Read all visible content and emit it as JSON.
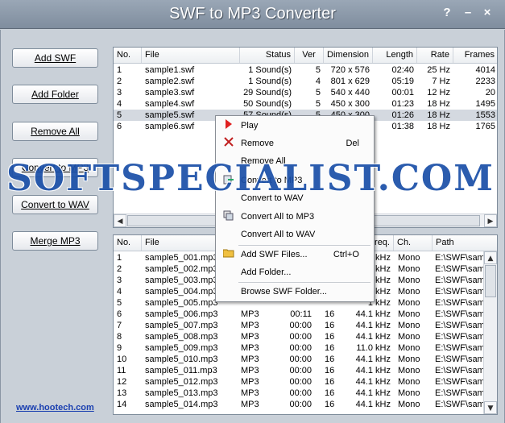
{
  "window": {
    "title": "SWF to MP3 Converter",
    "help_glyph": "?",
    "minimize_glyph": "–",
    "close_glyph": "×"
  },
  "sidebar": {
    "buttons": [
      {
        "label": "Add SWF"
      },
      {
        "label": "Add Folder"
      },
      {
        "label": "Remove All"
      },
      {
        "label": "Convert to MP3"
      },
      {
        "label": "Convert to WAV"
      },
      {
        "label": "Merge MP3"
      }
    ],
    "link": "www.hootech.com"
  },
  "swf_list": {
    "headers": [
      "No.",
      "File",
      "Status",
      "Ver",
      "Dimension",
      "Length",
      "Rate",
      "Frames"
    ],
    "rows": [
      {
        "no": "1",
        "file": "sample1.swf",
        "status": "1 Sound(s)",
        "ver": "5",
        "dim": "720 x 576",
        "length": "02:40",
        "rate": "25 Hz",
        "frames": "4014"
      },
      {
        "no": "2",
        "file": "sample2.swf",
        "status": "1 Sound(s)",
        "ver": "4",
        "dim": "801 x 629",
        "length": "05:19",
        "rate": "7 Hz",
        "frames": "2233"
      },
      {
        "no": "3",
        "file": "sample3.swf",
        "status": "29 Sound(s)",
        "ver": "5",
        "dim": "540 x 440",
        "length": "00:01",
        "rate": "12 Hz",
        "frames": "20"
      },
      {
        "no": "4",
        "file": "sample4.swf",
        "status": "50 Sound(s)",
        "ver": "5",
        "dim": "450 x 300",
        "length": "01:23",
        "rate": "18 Hz",
        "frames": "1495"
      },
      {
        "no": "5",
        "file": "sample5.swf",
        "status": "57 Sound(s)",
        "ver": "5",
        "dim": "450 x 300",
        "length": "01:26",
        "rate": "18 Hz",
        "frames": "1553"
      },
      {
        "no": "6",
        "file": "sample6.swf",
        "status": "",
        "ver": "",
        "dim": "",
        "length": "01:38",
        "rate": "18 Hz",
        "frames": "1765"
      }
    ],
    "selected_index": 4
  },
  "mp3_list": {
    "headers": [
      "No.",
      "File",
      "",
      "",
      "",
      "req.",
      "Ch.",
      "Path"
    ],
    "rows": [
      {
        "no": "1",
        "file": "sample5_001.mp3",
        "fmt": "",
        "len": "",
        "bits": "",
        "freq": "1 kHz",
        "ch": "Mono",
        "path": "E:\\SWF\\sam"
      },
      {
        "no": "2",
        "file": "sample5_002.mp3",
        "fmt": "",
        "len": "",
        "bits": "",
        "freq": "1 kHz",
        "ch": "Mono",
        "path": "E:\\SWF\\sam"
      },
      {
        "no": "3",
        "file": "sample5_003.mp3",
        "fmt": "",
        "len": "",
        "bits": "",
        "freq": "1 kHz",
        "ch": "Mono",
        "path": "E:\\SWF\\sam"
      },
      {
        "no": "4",
        "file": "sample5_004.mp3",
        "fmt": "",
        "len": "",
        "bits": "",
        "freq": "1 kHz",
        "ch": "Mono",
        "path": "E:\\SWF\\sam"
      },
      {
        "no": "5",
        "file": "sample5_005.mp3",
        "fmt": "",
        "len": "",
        "bits": "",
        "freq": "1 kHz",
        "ch": "Mono",
        "path": "E:\\SWF\\sam"
      },
      {
        "no": "6",
        "file": "sample5_006.mp3",
        "fmt": "MP3",
        "len": "00:11",
        "bits": "16",
        "freq": "44.1 kHz",
        "ch": "Mono",
        "path": "E:\\SWF\\sam"
      },
      {
        "no": "7",
        "file": "sample5_007.mp3",
        "fmt": "MP3",
        "len": "00:00",
        "bits": "16",
        "freq": "44.1 kHz",
        "ch": "Mono",
        "path": "E:\\SWF\\sam"
      },
      {
        "no": "8",
        "file": "sample5_008.mp3",
        "fmt": "MP3",
        "len": "00:00",
        "bits": "16",
        "freq": "44.1 kHz",
        "ch": "Mono",
        "path": "E:\\SWF\\sam"
      },
      {
        "no": "9",
        "file": "sample5_009.mp3",
        "fmt": "MP3",
        "len": "00:00",
        "bits": "16",
        "freq": "11.0 kHz",
        "ch": "Mono",
        "path": "E:\\SWF\\sam"
      },
      {
        "no": "10",
        "file": "sample5_010.mp3",
        "fmt": "MP3",
        "len": "00:00",
        "bits": "16",
        "freq": "44.1 kHz",
        "ch": "Mono",
        "path": "E:\\SWF\\sam"
      },
      {
        "no": "11",
        "file": "sample5_011.mp3",
        "fmt": "MP3",
        "len": "00:00",
        "bits": "16",
        "freq": "44.1 kHz",
        "ch": "Mono",
        "path": "E:\\SWF\\sam"
      },
      {
        "no": "12",
        "file": "sample5_012.mp3",
        "fmt": "MP3",
        "len": "00:00",
        "bits": "16",
        "freq": "44.1 kHz",
        "ch": "Mono",
        "path": "E:\\SWF\\sam"
      },
      {
        "no": "13",
        "file": "sample5_013.mp3",
        "fmt": "MP3",
        "len": "00:00",
        "bits": "16",
        "freq": "44.1 kHz",
        "ch": "Mono",
        "path": "E:\\SWF\\sam"
      },
      {
        "no": "14",
        "file": "sample5_014.mp3",
        "fmt": "MP3",
        "len": "00:00",
        "bits": "16",
        "freq": "44.1 kHz",
        "ch": "Mono",
        "path": "E:\\SWF\\sam"
      }
    ]
  },
  "context_menu": {
    "items": [
      {
        "label": "Play",
        "shortcut": "",
        "icon": "play-icon"
      },
      {
        "label": "Remove",
        "shortcut": "Del",
        "icon": "remove-x-icon"
      },
      {
        "label": "Remove All",
        "shortcut": "",
        "icon": ""
      },
      {
        "label": "Convert to MP3",
        "shortcut": "",
        "icon": "convert-icon"
      },
      {
        "label": "Convert to WAV",
        "shortcut": "",
        "icon": ""
      },
      {
        "label": "Convert All to MP3",
        "shortcut": "",
        "icon": "convert-all-icon"
      },
      {
        "label": "Convert All to WAV",
        "shortcut": "",
        "icon": ""
      },
      {
        "label": "Add SWF Files...",
        "shortcut": "Ctrl+O",
        "icon": "folder-open-icon"
      },
      {
        "label": "Add Folder...",
        "shortcut": "",
        "icon": ""
      },
      {
        "label": "Browse SWF Folder...",
        "shortcut": "",
        "icon": ""
      }
    ]
  },
  "watermark": {
    "text": "SOFTSPECIALIST.COM"
  },
  "colors": {
    "selection": "#d4d9e0",
    "watermark": "#1a4fa8",
    "link": "#1a3fb0"
  }
}
